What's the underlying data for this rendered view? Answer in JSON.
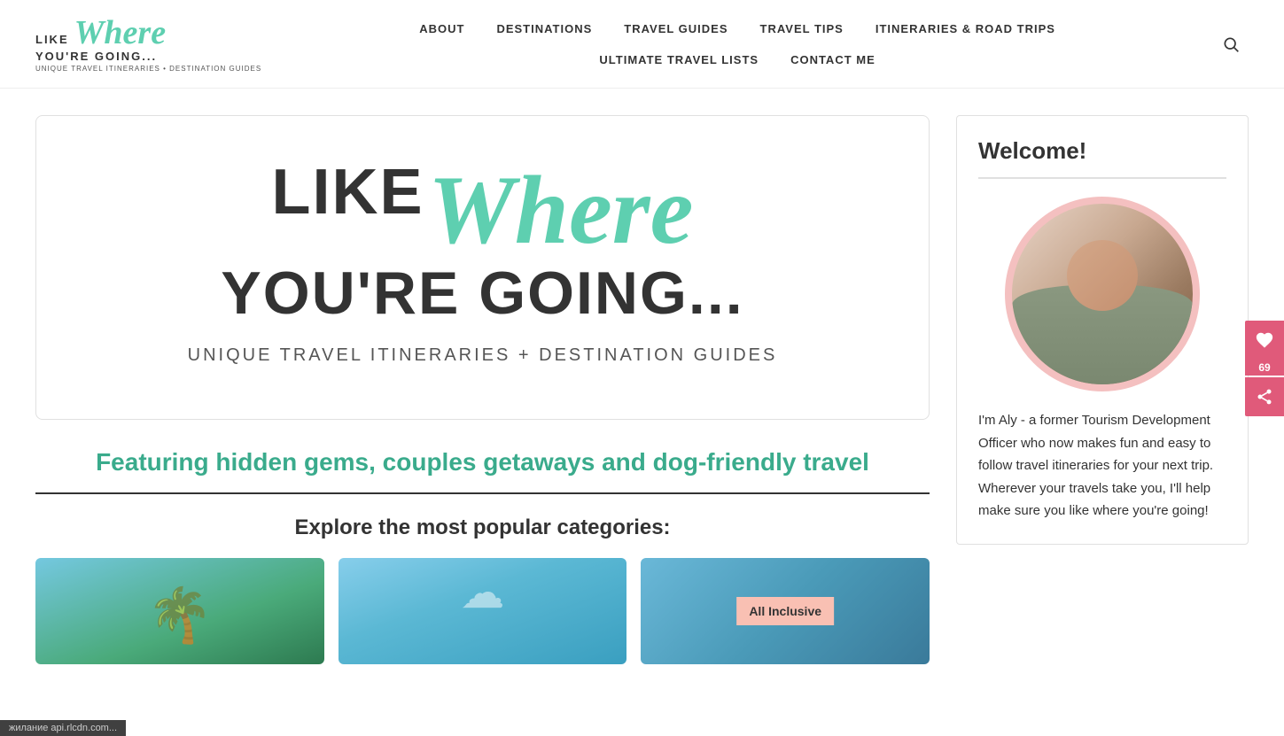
{
  "site": {
    "logo": {
      "like": "LIKE",
      "where": "Where",
      "youre": "YOU'RE GOING...",
      "tagline": "UNIQUE TRAVEL ITINERARIES • DESTINATION GUIDES"
    }
  },
  "nav": {
    "row1": [
      {
        "label": "ABOUT",
        "id": "about"
      },
      {
        "label": "DESTINATIONS",
        "id": "destinations"
      },
      {
        "label": "TRAVEL GUIDES",
        "id": "travel-guides"
      },
      {
        "label": "TRAVEL TIPS",
        "id": "travel-tips"
      },
      {
        "label": "ITINERARIES & ROAD TRIPS",
        "id": "itineraries"
      }
    ],
    "row2": [
      {
        "label": "ULTIMATE TRAVEL LISTS",
        "id": "travel-lists"
      },
      {
        "label": "CONTACT ME",
        "id": "contact"
      }
    ]
  },
  "hero": {
    "like": "LIKE",
    "where": "Where",
    "youre": "YOU'RE GOING...",
    "tagline": "UNIQUE TRAVEL ITINERARIES + DESTINATION GUIDES"
  },
  "featuring": {
    "text": "Featuring hidden gems, couples getaways and dog-friendly travel"
  },
  "explore": {
    "heading": "Explore the most popular categories:"
  },
  "categories": [
    {
      "id": "cat-1",
      "label": ""
    },
    {
      "id": "cat-2",
      "label": ""
    },
    {
      "id": "cat-3",
      "label": "All Inclusive"
    }
  ],
  "sidebar": {
    "welcome_title": "Welcome!",
    "bio": "I'm Aly - a former Tourism Development Officer who now makes fun and easy to follow travel itineraries for your next trip. Wherever your travels take you, I'll help make sure you like where you're going!"
  },
  "fab": {
    "count": "69"
  },
  "statusbar": {
    "text": "жилание api.rlcdn.com..."
  }
}
